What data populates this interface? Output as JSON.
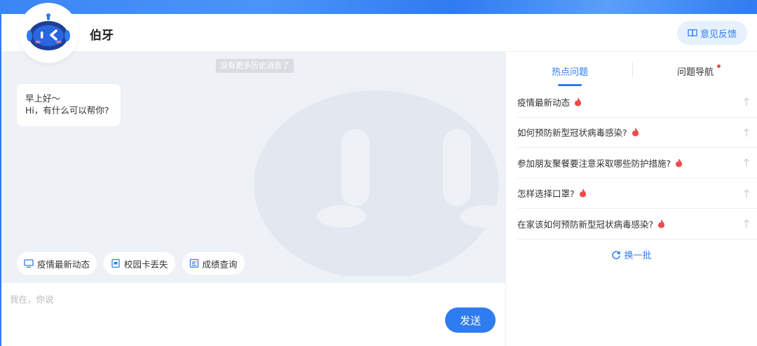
{
  "header": {
    "bot_name": "伯牙",
    "feedback_label": "意见反馈"
  },
  "chat": {
    "history_note": "没有更多历史消息了",
    "greeting_line1": "早上好～",
    "greeting_line2": "Hi，有什么可以帮你?",
    "quick_actions": [
      {
        "label": "疫情最新动态",
        "icon": "monitor-icon"
      },
      {
        "label": "校园卡丢失",
        "icon": "card-icon"
      },
      {
        "label": "成绩查询",
        "icon": "report-icon"
      }
    ]
  },
  "input": {
    "placeholder": "我在，你说",
    "send_label": "发送"
  },
  "side": {
    "tabs": [
      {
        "label": "热点问题",
        "active": true
      },
      {
        "label": "问题导航",
        "active": false,
        "dot": true
      }
    ],
    "questions": [
      "疫情最新动态",
      "如何预防新型冠状病毒感染?",
      "参加朋友聚餐要注意采取哪些防护措施?",
      "怎样选择口罩?",
      "在家该如何预防新型冠状病毒感染?"
    ],
    "refresh_label": "换一批"
  },
  "colors": {
    "accent": "#2f7bf0",
    "hot": "#f04a4a",
    "chat_bg": "#eef2f7"
  }
}
